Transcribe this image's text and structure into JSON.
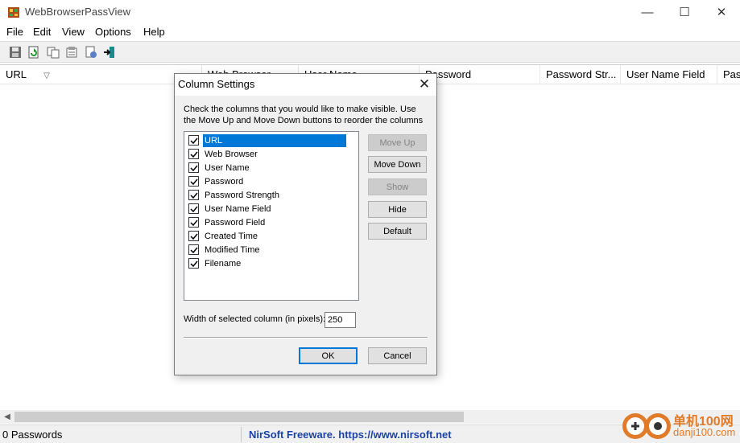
{
  "window": {
    "title": "WebBrowserPassView",
    "minimize_glyph": "—",
    "maximize_glyph": "☐",
    "close_glyph": "✕"
  },
  "menu": [
    "File",
    "Edit",
    "View",
    "Options",
    "Help"
  ],
  "toolbar": {
    "icons": [
      "save-icon",
      "refresh-icon",
      "copy-icon",
      "properties-icon",
      "html-report-icon",
      "exit-icon"
    ]
  },
  "list": {
    "columns": [
      "URL",
      "Web Browser",
      "User Name",
      "Password",
      "Password Str...",
      "User Name Field",
      "Pas"
    ],
    "sort_glyph": "▽"
  },
  "status": {
    "count": "0 Passwords",
    "link": "NirSoft Freeware. https://www.nirsoft.net"
  },
  "watermark": {
    "line1": "单机100网",
    "line2": "danji100.com"
  },
  "dialog": {
    "title": "Column Settings",
    "close_glyph": "✕",
    "instructions": "Check the columns that you would like to make visible. Use the Move Up and Move Down buttons to reorder the columns",
    "columns": [
      {
        "label": "URL",
        "checked": true,
        "selected": true
      },
      {
        "label": "Web Browser",
        "checked": true
      },
      {
        "label": "User Name",
        "checked": true
      },
      {
        "label": "Password",
        "checked": true
      },
      {
        "label": "Password Strength",
        "checked": true
      },
      {
        "label": "User Name Field",
        "checked": true
      },
      {
        "label": "Password Field",
        "checked": true
      },
      {
        "label": "Created Time",
        "checked": true
      },
      {
        "label": "Modified Time",
        "checked": true
      },
      {
        "label": "Filename",
        "checked": true
      }
    ],
    "buttons": {
      "move_up": "Move Up",
      "move_down": "Move Down",
      "show": "Show",
      "hide": "Hide",
      "default": "Default",
      "ok": "OK",
      "cancel": "Cancel"
    },
    "width_label": "Width of selected column (in pixels):",
    "width_value": "250"
  },
  "colors": {
    "selection": "#0078d7",
    "link": "#1a43a7",
    "watermark": "#e07b2a"
  }
}
